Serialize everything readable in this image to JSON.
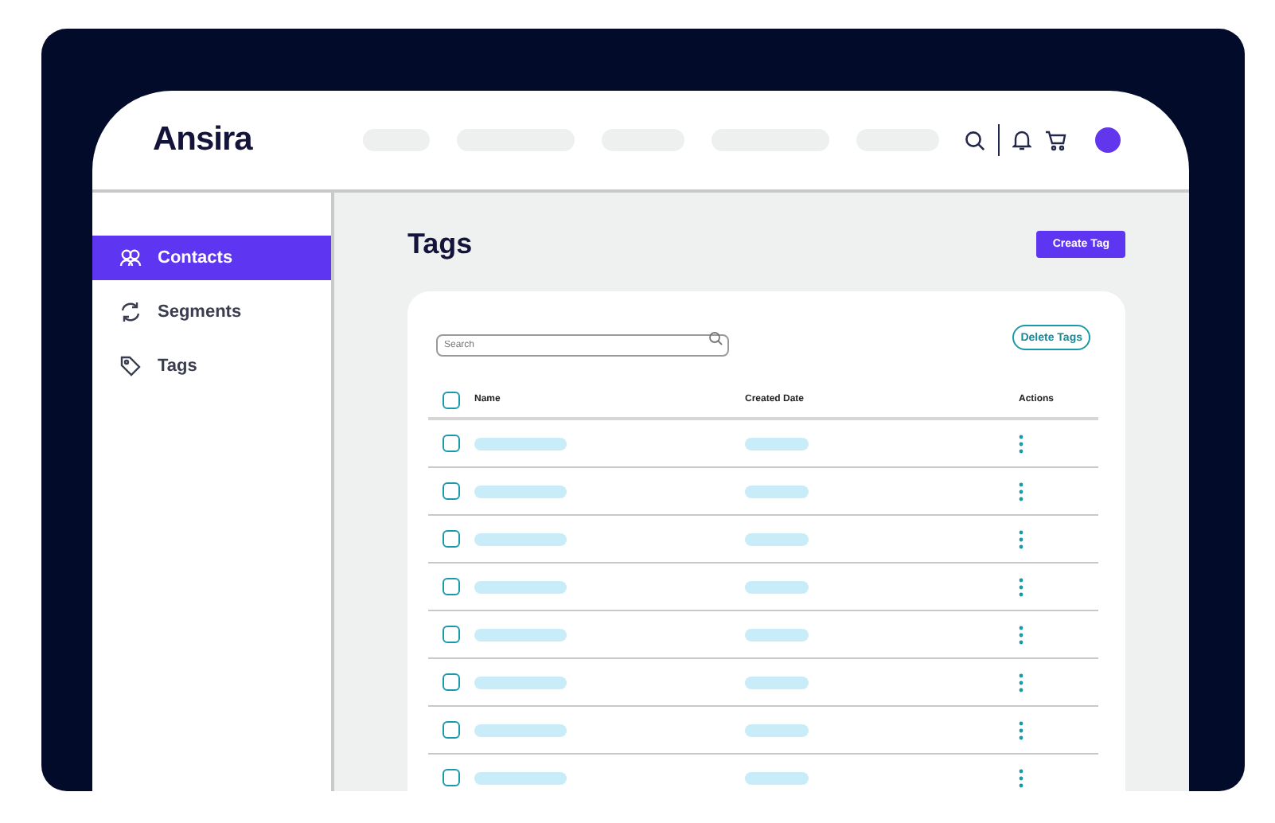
{
  "header": {
    "logo": "Ansira"
  },
  "sidebar": {
    "items": [
      {
        "label": "Contacts",
        "selected": true
      },
      {
        "label": "Segments",
        "selected": false
      },
      {
        "label": "Tags",
        "selected": false
      }
    ]
  },
  "page": {
    "title": "Tags",
    "create_button": "Create Tag"
  },
  "table": {
    "search": {
      "placeholder": "Search"
    },
    "delete_button": "Delete Tags",
    "select_all": {
      "checked": false
    },
    "columns": [
      "Name",
      "Created Date",
      "Actions"
    ],
    "rows": [
      {
        "checked": false
      },
      {
        "checked": false
      },
      {
        "checked": false
      },
      {
        "checked": false
      },
      {
        "checked": false
      },
      {
        "checked": false
      },
      {
        "checked": false
      },
      {
        "checked": false
      }
    ]
  }
}
